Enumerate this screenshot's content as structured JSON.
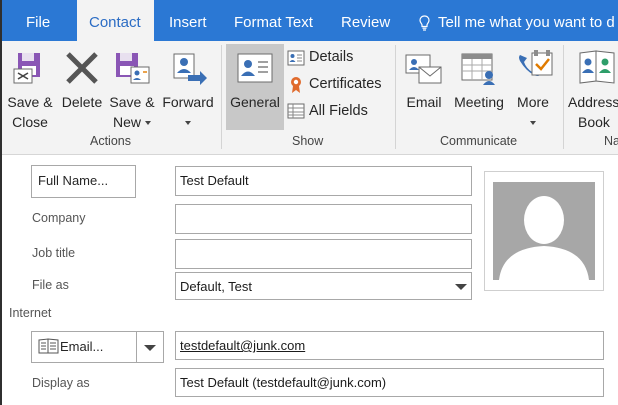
{
  "tabs": [
    {
      "label": "File",
      "active": false
    },
    {
      "label": "Contact",
      "active": true
    },
    {
      "label": "Insert",
      "active": false
    },
    {
      "label": "Format Text",
      "active": false
    },
    {
      "label": "Review",
      "active": false
    }
  ],
  "tell_me": "Tell me what you want to d",
  "ribbon": {
    "actions": {
      "save_close": [
        "Save &",
        "Close"
      ],
      "delete": "Delete",
      "save_new": [
        "Save &",
        "New"
      ],
      "forward": "Forward",
      "group_label": "Actions"
    },
    "show": {
      "general": "General",
      "details": "Details",
      "certificates": "Certificates",
      "all_fields": "All Fields",
      "group_label": "Show"
    },
    "communicate": {
      "email": "Email",
      "meeting": "Meeting",
      "more": "More",
      "group_label": "Communicate"
    },
    "names": {
      "address_book": [
        "Address",
        "Book"
      ],
      "group_label": "Na"
    }
  },
  "form": {
    "full_name_button": "Full Name...",
    "full_name_value": "Test Default",
    "company_label": "Company",
    "company_value": "",
    "job_title_label": "Job title",
    "job_title_value": "",
    "file_as_label": "File as",
    "file_as_value": "Default, Test",
    "internet_label": "Internet",
    "email_button": "Email...",
    "email_value": "testdefault@junk.com",
    "display_as_label": "Display as",
    "display_as_value": "Test Default (testdefault@junk.com)"
  },
  "colors": {
    "tab_bar": "#2b78d4",
    "ribbon_bg": "#f3f3f3",
    "active_tab_text": "#2b6cc4",
    "selected_button_bg": "#c8c8c8",
    "photo_placeholder": "#a7a7a7"
  },
  "icons": [
    "lightbulb-icon",
    "save-close-icon",
    "delete-x-icon",
    "save-new-icon",
    "forward-icon",
    "general-card-icon",
    "details-icon",
    "certificates-ribbon-icon",
    "all-fields-grid-icon",
    "email-contact-icon",
    "meeting-calendar-icon",
    "more-phone-check-icon",
    "address-book-icon",
    "contact-photo-placeholder-icon",
    "address-card-icon",
    "dropdown-arrow-icon"
  ]
}
